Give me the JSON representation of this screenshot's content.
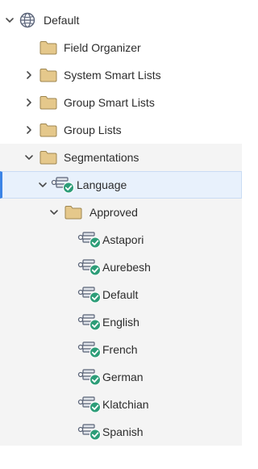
{
  "tree": {
    "root": {
      "label": "Default",
      "icon": "globe-icon",
      "expanded": true
    },
    "field_organizer": {
      "label": "Field Organizer",
      "icon": "folder-icon"
    },
    "system_smart_lists": {
      "label": "System Smart Lists",
      "icon": "folder-icon",
      "expanded": false
    },
    "group_smart_lists": {
      "label": "Group Smart Lists",
      "icon": "folder-icon",
      "expanded": false
    },
    "group_lists": {
      "label": "Group Lists",
      "icon": "folder-icon",
      "expanded": false
    },
    "segmentations": {
      "label": "Segmentations",
      "icon": "folder-icon",
      "expanded": true
    },
    "language": {
      "label": "Language",
      "icon": "segmentation-approved-icon",
      "expanded": true,
      "selected": true
    },
    "approved": {
      "label": "Approved",
      "icon": "folder-icon",
      "expanded": true
    },
    "segments": [
      {
        "label": "Astapori",
        "icon": "segment-approved-icon"
      },
      {
        "label": "Aurebesh",
        "icon": "segment-approved-icon"
      },
      {
        "label": "Default",
        "icon": "segment-approved-icon"
      },
      {
        "label": "English",
        "icon": "segment-approved-icon"
      },
      {
        "label": "French",
        "icon": "segment-approved-icon"
      },
      {
        "label": "German",
        "icon": "segment-approved-icon"
      },
      {
        "label": "Klatchian",
        "icon": "segment-approved-icon"
      },
      {
        "label": "Spanish",
        "icon": "segment-approved-icon"
      }
    ]
  },
  "colors": {
    "folder_fill": "#e5c88b",
    "folder_stroke": "#9e8650",
    "chevron": "#4b4b4b",
    "selection_accent": "#3b84e6",
    "selection_bg": "#e8f1fc",
    "check_green": "#2d9d78",
    "shaded_bg": "#f4f4f4"
  }
}
